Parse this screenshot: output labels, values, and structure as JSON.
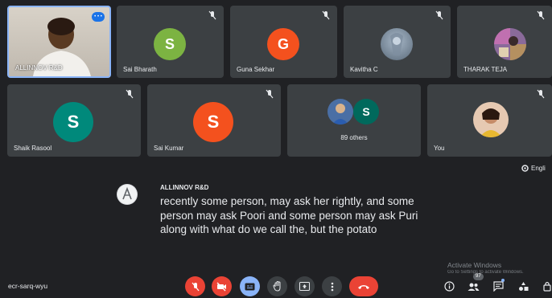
{
  "participants_row1": [
    {
      "name": "ALLINNOV R&D",
      "type": "video",
      "self_badge": "• • •"
    },
    {
      "name": "Sai Bharath",
      "type": "initial",
      "initial": "S",
      "color": "#7cb342"
    },
    {
      "name": "Guna Sekhar",
      "type": "initial",
      "initial": "G",
      "color": "#f4511e"
    },
    {
      "name": "Kavitha C",
      "type": "photo"
    },
    {
      "name": "THARAK TEJA",
      "type": "photo"
    }
  ],
  "participants_row2": [
    {
      "name": "Shaik Rasool",
      "type": "initial",
      "initial": "S",
      "color": "#00897b"
    },
    {
      "name": "Sai Kumar",
      "type": "initial",
      "initial": "S",
      "color": "#f4511e"
    },
    {
      "name": "89 others",
      "type": "group",
      "initial": "S",
      "color": "#00695c"
    },
    {
      "name": "You",
      "type": "photo"
    }
  ],
  "captions": {
    "speaker": "ALLINNOV R&D",
    "text": "recently some person, may ask her rightly, and some person may ask Poori and some person may ask Puri along with what do we call the, but the potato",
    "language": "Engli"
  },
  "meeting_code": "ecr-sarq-wyu",
  "watermark": {
    "line1": "Activate Windows",
    "line2": "Go to Settings to activate Windows."
  },
  "people_count": "97",
  "colors": {
    "background": "#202124",
    "tile": "#3c4043",
    "end_call": "#ea4335",
    "cc_active": "#8ab4f8"
  }
}
